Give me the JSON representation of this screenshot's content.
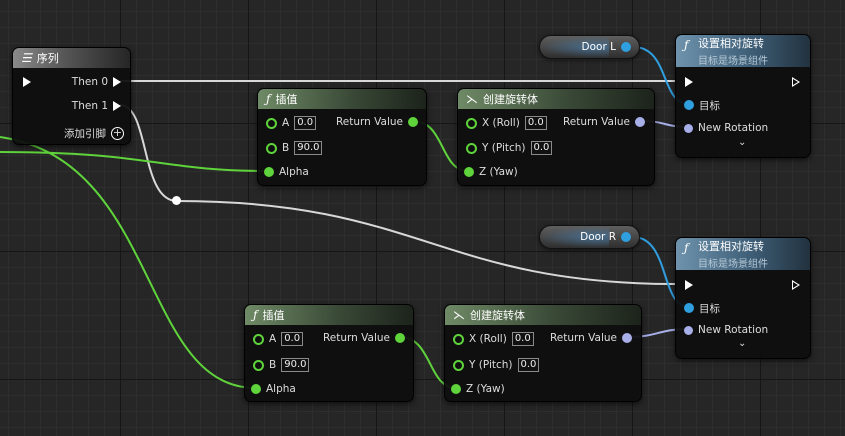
{
  "sequence": {
    "title": "序列",
    "then0": "Then 0",
    "then1": "Then 1",
    "add_pin": "添加引脚"
  },
  "lerp_top": {
    "title": "插值",
    "a_label": "A",
    "a_value": "0.0",
    "b_label": "B",
    "b_value": "90.0",
    "alpha_label": "Alpha",
    "return_label": "Return Value"
  },
  "lerp_bottom": {
    "title": "插值",
    "a_label": "A",
    "a_value": "0.0",
    "b_label": "B",
    "b_value": "90.0",
    "alpha_label": "Alpha",
    "return_label": "Return Value"
  },
  "make_rot_top": {
    "title": "创建旋转体",
    "x_label": "X (Roll)",
    "x_value": "0.0",
    "y_label": "Y (Pitch)",
    "y_value": "0.0",
    "z_label": "Z (Yaw)",
    "return_label": "Return Value"
  },
  "make_rot_bottom": {
    "title": "创建旋转体",
    "x_label": "X (Roll)",
    "x_value": "0.0",
    "y_label": "Y (Pitch)",
    "y_value": "0.0",
    "z_label": "Z (Yaw)",
    "return_label": "Return Value"
  },
  "door_l": {
    "label": "Door L"
  },
  "door_r": {
    "label": "Door R"
  },
  "set_rot_top": {
    "title": "设置相对旋转",
    "subtitle": "目标是场景组件",
    "target_label": "目标",
    "new_rotation_label": "New Rotation"
  },
  "set_rot_bottom": {
    "title": "设置相对旋转",
    "subtitle": "目标是场景组件",
    "target_label": "目标",
    "new_rotation_label": "New Rotation"
  },
  "icons": {
    "function": "ƒ",
    "sequence": "☰",
    "make_rotator": "⋋",
    "add": "+",
    "expand": "⌄"
  },
  "colors": {
    "float_pin": "#5fd33b",
    "object_pin": "#2f9fe0",
    "rotator_pin": "#a7aee8",
    "exec": "#ffffff"
  }
}
